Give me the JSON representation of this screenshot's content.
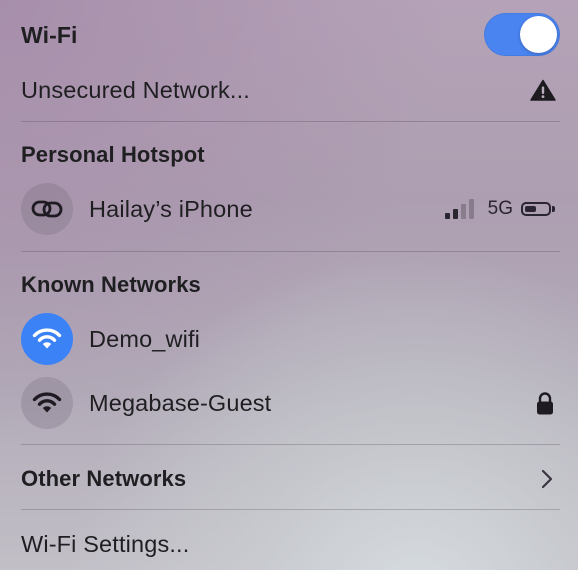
{
  "header": {
    "title": "Wi-Fi",
    "wifi_enabled": true,
    "toggle_color": "#4a84f0"
  },
  "unsecured": {
    "label": "Unsecured Network...",
    "icon": "warning-triangle-icon"
  },
  "hotspot": {
    "title": "Personal Hotspot",
    "device": {
      "name": "Hailay’s iPhone",
      "icon": "link-icon",
      "signal_bars_active": 2,
      "signal_bars_total": 4,
      "network_type": "5G",
      "battery_level": 0.4
    }
  },
  "known": {
    "title": "Known Networks",
    "networks": [
      {
        "name": "Demo_wifi",
        "connected": true,
        "icon": "wifi-icon",
        "locked": false
      },
      {
        "name": "Megabase-Guest",
        "connected": false,
        "icon": "wifi-icon",
        "locked": true
      }
    ]
  },
  "other": {
    "label": "Other Networks",
    "icon": "chevron-right-icon"
  },
  "settings": {
    "label": "Wi-Fi Settings..."
  }
}
